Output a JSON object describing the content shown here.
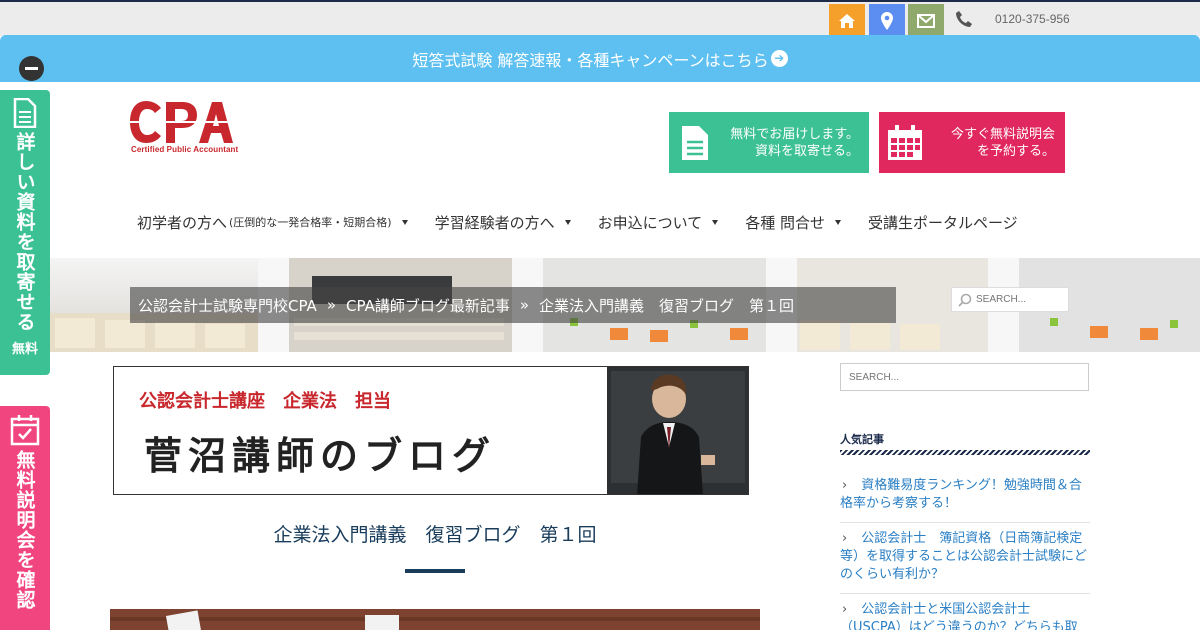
{
  "topbar": {
    "phone": "0120-375-956",
    "icons": [
      "home-icon",
      "map-pin-icon",
      "mail-icon",
      "phone-icon"
    ],
    "colors": {
      "home": "#f5a02a",
      "map": "#5b8ef0",
      "mail": "#8fa86c"
    }
  },
  "banner": {
    "text": "短答式試験 解答速報・各種キャンペーンはこちら",
    "color": "#5ec0f0"
  },
  "side_tabs": {
    "materials": {
      "label": "詳しい資料を取寄せる",
      "sub": "無料",
      "color": "#3cc195"
    },
    "seminar": {
      "label": "無料説明会を確認",
      "color": "#f0457e"
    }
  },
  "logo": {
    "text": "CPA",
    "subtitle": "Certified Public Accountant"
  },
  "cta": {
    "documents": {
      "line1": "無料でお届けします。",
      "line2": "資料を取寄せる。"
    },
    "seminar": {
      "line1": "今すぐ無料説明会",
      "line2": "を予約する。"
    }
  },
  "nav": {
    "items": [
      {
        "label": "初学者の方へ",
        "note": "(圧倒的な一発合格率・短期合格)",
        "dropdown": true
      },
      {
        "label": "学習経験者の方へ",
        "dropdown": true
      },
      {
        "label": "お申込について",
        "dropdown": true
      },
      {
        "label": "各種 問合せ",
        "dropdown": true
      },
      {
        "label": "受講生ポータルページ",
        "dropdown": false
      }
    ]
  },
  "breadcrumb": {
    "items": [
      "公認会計士試験専門校CPA",
      "CPA講師ブログ最新記事",
      "企業法入門講義　復習ブログ　第１回"
    ],
    "separator": "»"
  },
  "hero_search": {
    "placeholder": "SEARCH..."
  },
  "blog_header": {
    "role": "公認会計士講座　企業法　担当",
    "title": "菅沼講師のブログ"
  },
  "post": {
    "title": "企業法入門講義　復習ブログ　第１回"
  },
  "sidebar": {
    "search_placeholder": "SEARCH...",
    "heading": "人気記事",
    "articles": [
      "資格難易度ランキング！勉強時間＆合格率から考察する！",
      "公認会計士　簿記資格（日商簿記検定等）を取得することは公認会計士試験にどのくらい有利か？",
      "公認会計士と米国公認会計士（USCPA）はどう違うのか？どちらも取"
    ]
  }
}
